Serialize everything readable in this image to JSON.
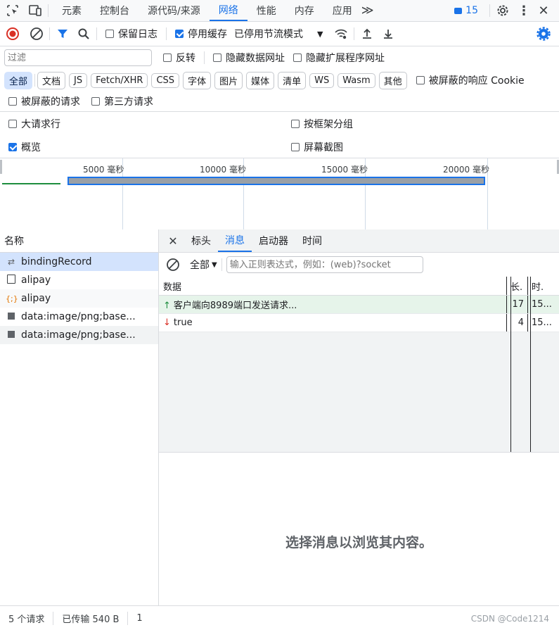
{
  "tabbar": {
    "tabs": [
      "元素",
      "控制台",
      "源代码/来源",
      "网络",
      "性能",
      "内存",
      "应用"
    ],
    "active": 3,
    "more": "≫",
    "issues_count": "15"
  },
  "toolbar": {
    "preserve_log": "保留日志",
    "disable_cache": "停用缓存",
    "throttle": "已停用节流模式"
  },
  "filter": {
    "placeholder": "过滤",
    "invert": "反转",
    "hide_data_urls": "隐藏数据网址",
    "hide_ext_urls": "隐藏扩展程序网址"
  },
  "chips": [
    "全部",
    "文档",
    "JS",
    "Fetch/XHR",
    "CSS",
    "字体",
    "图片",
    "媒体",
    "清单",
    "WS",
    "Wasm",
    "其他"
  ],
  "blocked_cookies": "被屏蔽的响应 Cookie",
  "blocked_requests": "被屏蔽的请求",
  "third_party": "第三方请求",
  "options": {
    "big_rows": "大请求行",
    "group_by_frame": "按框架分组",
    "overview": "概览",
    "screenshots": "屏幕截图"
  },
  "overview_ticks": [
    "5000 毫秒",
    "10000 毫秒",
    "15000 毫秒",
    "20000 毫秒"
  ],
  "requests": {
    "header": "名称",
    "items": [
      {
        "name": "bindingRecord",
        "icon": "websocket-icon"
      },
      {
        "name": "alipay",
        "icon": "document-icon"
      },
      {
        "name": "alipay",
        "icon": "script-icon"
      },
      {
        "name": "data:image/png;base...",
        "icon": "image-icon"
      },
      {
        "name": "data:image/png;base...",
        "icon": "image-icon"
      }
    ]
  },
  "detail": {
    "tabs": [
      "标头",
      "消息",
      "启动器",
      "时间"
    ],
    "active": 1,
    "filter_type": "全部",
    "filter_placeholder": "输入正则表达式，例如：(web)?socket",
    "columns": [
      "数据",
      "长.",
      "时."
    ],
    "messages": [
      {
        "dir": "up",
        "data": "客户端向8989端口发送请求...",
        "length": "17",
        "time": "15..."
      },
      {
        "dir": "down",
        "data": "true",
        "length": "4",
        "time": "15..."
      }
    ],
    "empty_hint": "选择消息以浏览其内容。"
  },
  "status": {
    "requests": "5 个请求",
    "transferred": "已传输 540 B",
    "more": "1"
  },
  "watermark": "CSDN @Code1214",
  "colors": {
    "accent": "#1a73e8",
    "record": "#d93025",
    "sent_bg": "#e6f4ea"
  }
}
